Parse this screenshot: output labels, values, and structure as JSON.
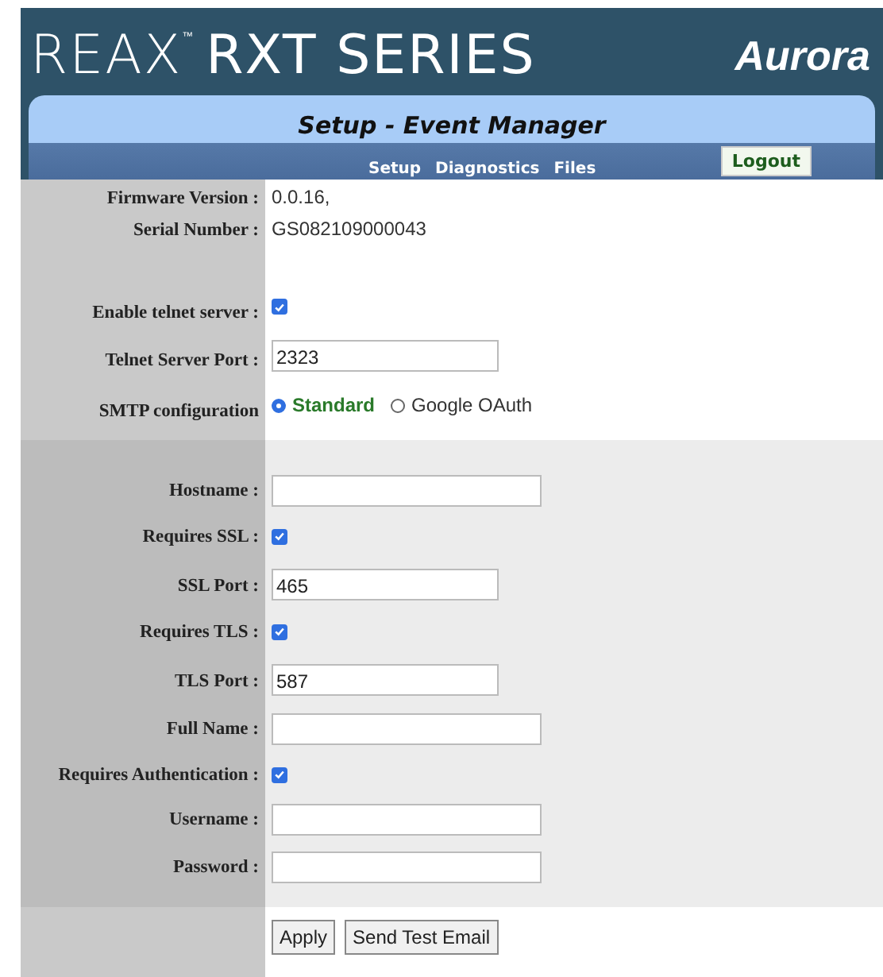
{
  "header": {
    "brand": "REAX",
    "brand_mark": "™",
    "product": "RXT SERIES",
    "company": "Aurora"
  },
  "title": "Setup - Event Manager",
  "nav": [
    {
      "label": "Setup"
    },
    {
      "label": "Diagnostics"
    },
    {
      "label": "Files"
    }
  ],
  "logout": "Logout",
  "device_info": [
    {
      "kind": "text",
      "label": "Firmware Version :",
      "value": "0.0.16,"
    },
    {
      "kind": "text",
      "label": "Serial Number :",
      "value": "GS082109000043"
    }
  ],
  "telnet": [
    {
      "kind": "checkbox",
      "label": "Enable telnet server :",
      "checked": true
    },
    {
      "kind": "port",
      "label": "Telnet Server Port :",
      "value": "2323"
    },
    {
      "kind": "radio",
      "label": "SMTP configuration",
      "options": [
        {
          "label": "Standard",
          "selected": true
        },
        {
          "label": "Google OAuth",
          "selected": false
        }
      ]
    }
  ],
  "smtp": [
    {
      "kind": "field",
      "label": "Hostname :"
    },
    {
      "kind": "checkbox",
      "label": "Requires SSL :",
      "checked": true
    },
    {
      "kind": "port",
      "label": "SSL Port :",
      "value": "465"
    },
    {
      "kind": "checkbox",
      "label": "Requires TLS :",
      "checked": true
    },
    {
      "kind": "port",
      "label": "TLS Port :",
      "value": "587"
    },
    {
      "kind": "field",
      "label": "Full Name :"
    },
    {
      "kind": "checkbox",
      "label": "Requires Authentication :",
      "checked": true
    },
    {
      "kind": "field",
      "label": "Username :"
    },
    {
      "kind": "field",
      "label": "Password :"
    }
  ],
  "buttons": [
    "Apply",
    "Send Test Email"
  ]
}
